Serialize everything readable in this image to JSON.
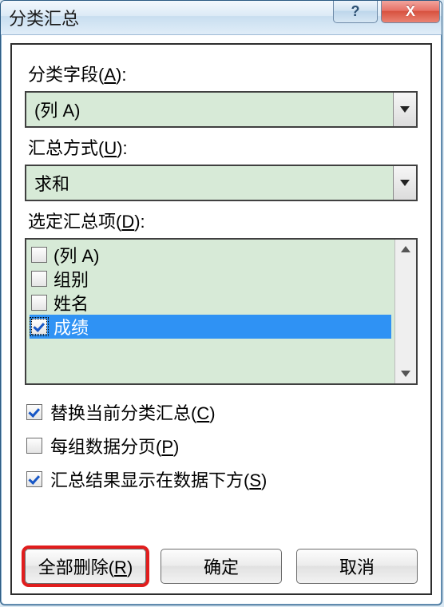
{
  "titlebar": {
    "title": "分类汇总",
    "help_symbol": "?",
    "close_symbol": "X"
  },
  "labels": {
    "group_by": "分类字段(",
    "group_by_key": "A",
    "group_by_suffix": "):",
    "use_function": "汇总方式(",
    "use_function_key": "U",
    "use_function_suffix": "):",
    "add_subtotal": "选定汇总项(",
    "add_subtotal_key": "D",
    "add_subtotal_suffix": "):"
  },
  "combo_group_by": {
    "value": "(列 A)"
  },
  "combo_function": {
    "value": "求和"
  },
  "subtotal_items": [
    {
      "label": "(列 A)",
      "checked": false,
      "selected": false
    },
    {
      "label": "组别",
      "checked": false,
      "selected": false
    },
    {
      "label": "姓名",
      "checked": false,
      "selected": false
    },
    {
      "label": "成绩",
      "checked": true,
      "selected": true
    }
  ],
  "options": {
    "replace": {
      "label": "替换当前分类汇总(",
      "key": "C",
      "suffix": ")",
      "checked": true
    },
    "pagebreak": {
      "label": "每组数据分页(",
      "key": "P",
      "suffix": ")",
      "checked": false
    },
    "below": {
      "label": "汇总结果显示在数据下方(",
      "key": "S",
      "suffix": ")",
      "checked": true
    }
  },
  "buttons": {
    "remove_all": {
      "label": "全部删除(",
      "key": "R",
      "suffix": ")"
    },
    "ok": "确定",
    "cancel": "取消"
  }
}
